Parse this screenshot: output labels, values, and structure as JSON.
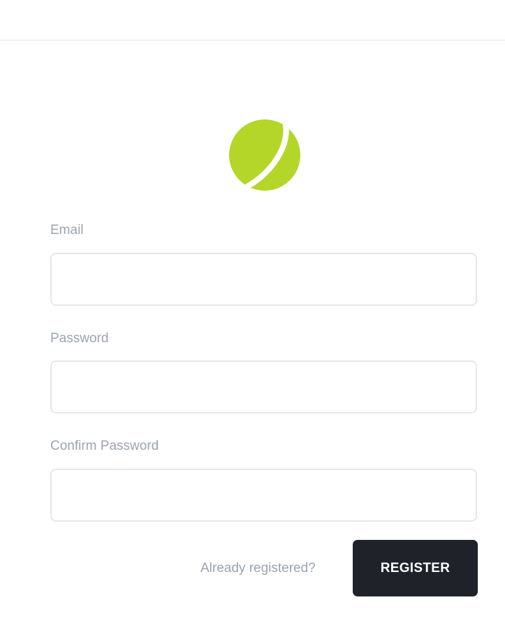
{
  "brand": {
    "logo_icon": "lime-ball-logo-icon",
    "accent_color": "#b4d628"
  },
  "form": {
    "email": {
      "label": "Email",
      "value": "",
      "placeholder": ""
    },
    "password": {
      "label": "Password",
      "value": "",
      "placeholder": ""
    },
    "confirm_password": {
      "label": "Confirm Password",
      "value": "",
      "placeholder": ""
    },
    "login_link_label": "Already registered?",
    "register_button_label": "REGISTER",
    "button_color": "#1f2329"
  }
}
